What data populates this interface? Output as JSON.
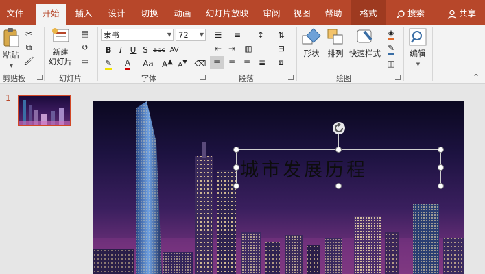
{
  "tabs": [
    {
      "label": "文件"
    },
    {
      "label": "开始",
      "active": true
    },
    {
      "label": "插入"
    },
    {
      "label": "设计"
    },
    {
      "label": "切换"
    },
    {
      "label": "动画"
    },
    {
      "label": "幻灯片放映"
    },
    {
      "label": "审阅"
    },
    {
      "label": "视图"
    },
    {
      "label": "帮助"
    },
    {
      "label": "格式",
      "context": true
    }
  ],
  "search_label": "搜索",
  "share_label": "共享",
  "ribbon": {
    "clipboard": {
      "paste": "粘贴",
      "group": "剪贴板"
    },
    "slides": {
      "new_slide_line1": "新建",
      "new_slide_line2": "幻灯片",
      "group": "幻灯片"
    },
    "font": {
      "font_name": "隶书",
      "font_size": "72",
      "group": "字体"
    },
    "paragraph": {
      "group": "段落"
    },
    "drawing": {
      "shape": "形状",
      "arrange": "排列",
      "quick_style": "快速样式",
      "group": "绘图"
    },
    "editing": {
      "edit": "编辑"
    }
  },
  "thumbnails": [
    {
      "number": "1"
    }
  ],
  "slide": {
    "title": "城市发展历程"
  },
  "colors": {
    "accent": "#b7472a",
    "context_tab": "#9e3a20"
  }
}
